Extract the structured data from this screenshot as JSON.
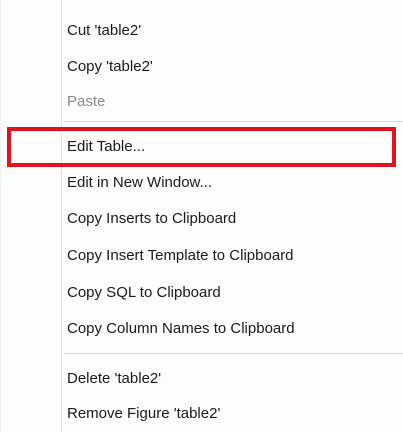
{
  "context_menu": {
    "items": [
      {
        "label": "Cut 'table2'",
        "enabled": true
      },
      {
        "label": "Copy 'table2'",
        "enabled": true
      },
      {
        "label": "Paste",
        "enabled": false
      },
      {
        "label": "Edit Table...",
        "enabled": true,
        "highlighted": true
      },
      {
        "label": "Edit in New Window...",
        "enabled": true
      },
      {
        "label": "Copy Inserts to Clipboard",
        "enabled": true
      },
      {
        "label": "Copy Insert Template to Clipboard",
        "enabled": true
      },
      {
        "label": "Copy SQL to Clipboard",
        "enabled": true
      },
      {
        "label": "Copy Column Names to Clipboard",
        "enabled": true
      },
      {
        "label": "Delete 'table2'",
        "enabled": true
      },
      {
        "label": "Remove Figure 'table2'",
        "enabled": true
      }
    ]
  },
  "colors": {
    "highlight_border": "#e0141c",
    "enabled_text": "#1a1a1a",
    "disabled_text": "#8a8a8a",
    "separator": "#d9d9d9",
    "menu_background": "#fdfdfd"
  }
}
